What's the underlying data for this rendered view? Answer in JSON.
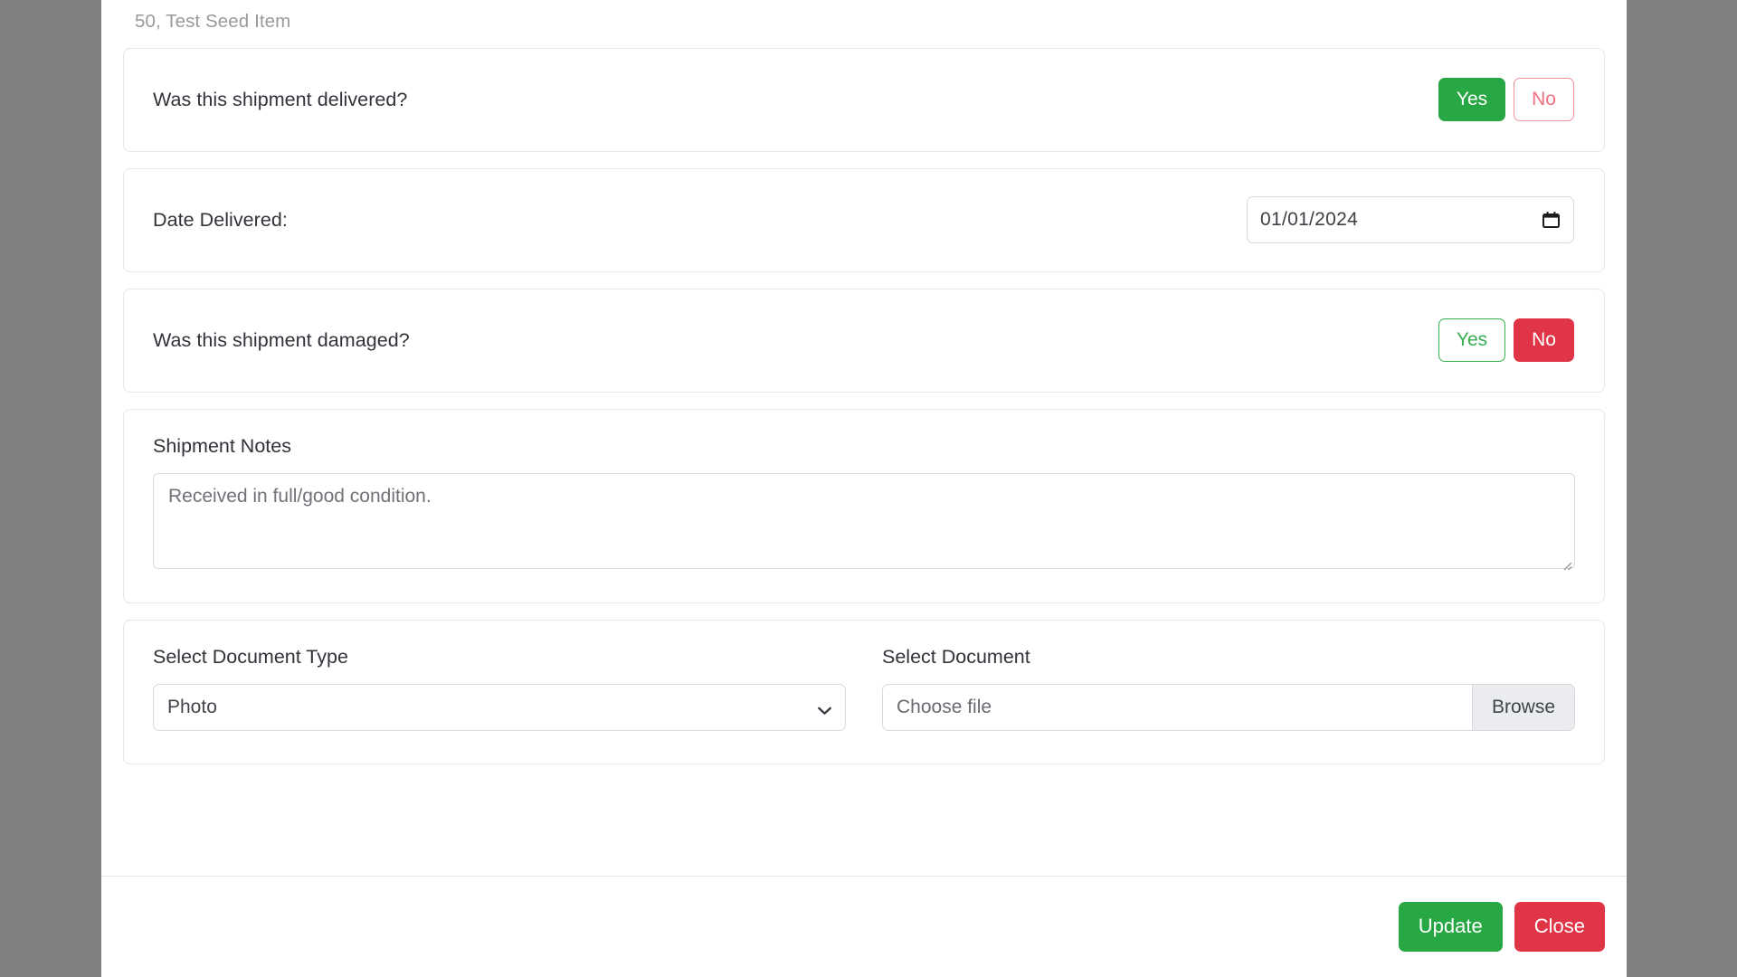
{
  "modal": {
    "subtitle": "50, Test Seed Item",
    "sections": {
      "delivered": {
        "label": "Was this shipment delivered?",
        "yes_label": "Yes",
        "no_label": "No",
        "selected": "Yes"
      },
      "date_delivered": {
        "label": "Date Delivered:",
        "value": "01/01/2024",
        "icon": "calendar-icon"
      },
      "damaged": {
        "label": "Was this shipment damaged?",
        "yes_label": "Yes",
        "no_label": "No",
        "selected": "No"
      },
      "notes": {
        "label": "Shipment Notes",
        "value": "Received in full/good condition.",
        "placeholder": "Received in full/good condition."
      },
      "documents": {
        "type_label": "Select Document Type",
        "type_value": "Photo",
        "type_options": [
          "Photo"
        ],
        "type_icon": "chevron-down-icon",
        "document_label": "Select Document",
        "file_placeholder": "Choose file",
        "browse_label": "Browse"
      }
    },
    "footer": {
      "update_label": "Update",
      "close_label": "Close"
    }
  },
  "colors": {
    "backdrop": "#808080",
    "success": "#28a745",
    "danger": "#e03546",
    "success_outline": "#36af50",
    "danger_outline": "#f0707f",
    "border": "#e6e6e8",
    "muted_text": "#9a9a9e"
  }
}
